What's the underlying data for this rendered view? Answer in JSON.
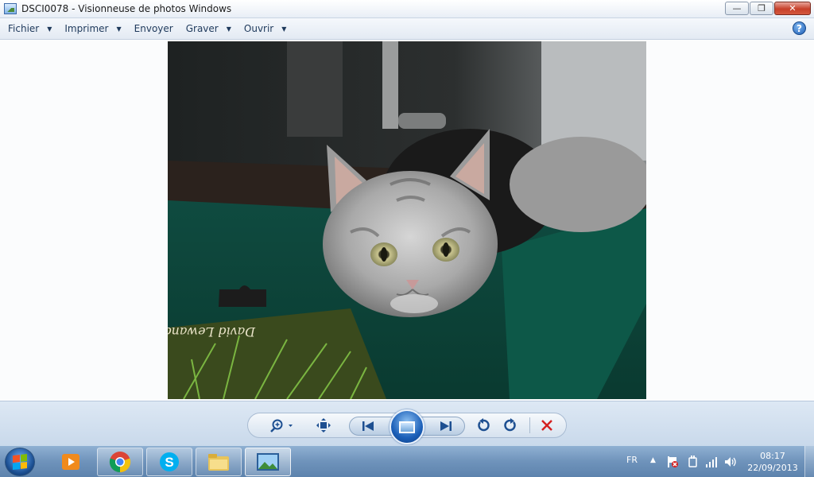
{
  "window": {
    "title": "DSCI0078 - Visionneuse de photos Windows",
    "minimize_glyph": "—",
    "restore_glyph": "❐",
    "close_glyph": "✕"
  },
  "menu": {
    "items": [
      {
        "label": "Fichier",
        "has_dropdown": true
      },
      {
        "label": "Imprimer",
        "has_dropdown": true
      },
      {
        "label": "Envoyer",
        "has_dropdown": false
      },
      {
        "label": "Graver",
        "has_dropdown": true
      },
      {
        "label": "Ouvrir",
        "has_dropdown": true
      }
    ],
    "help_glyph": "?"
  },
  "photo": {
    "subject_icon": "tabby-kitten-photo",
    "overlay_text": "David Lewand"
  },
  "controls": {
    "icons": [
      "zoom-icon",
      "actual-size-icon",
      "previous-icon",
      "slideshow-icon",
      "next-icon",
      "rotate-left-icon",
      "rotate-right-icon",
      "delete-icon"
    ],
    "delete_color": "#d42020"
  },
  "taskbar": {
    "apps": [
      "start-button",
      "media-player",
      "chrome",
      "skype",
      "windows-explorer",
      "photo-viewer"
    ],
    "tray": {
      "language": "FR",
      "icons": [
        "show-hidden-icon",
        "action-center-flag-icon",
        "power-icon",
        "network-signal-icon",
        "volume-icon"
      ],
      "time": "08:17",
      "date": "22/09/2013"
    }
  }
}
